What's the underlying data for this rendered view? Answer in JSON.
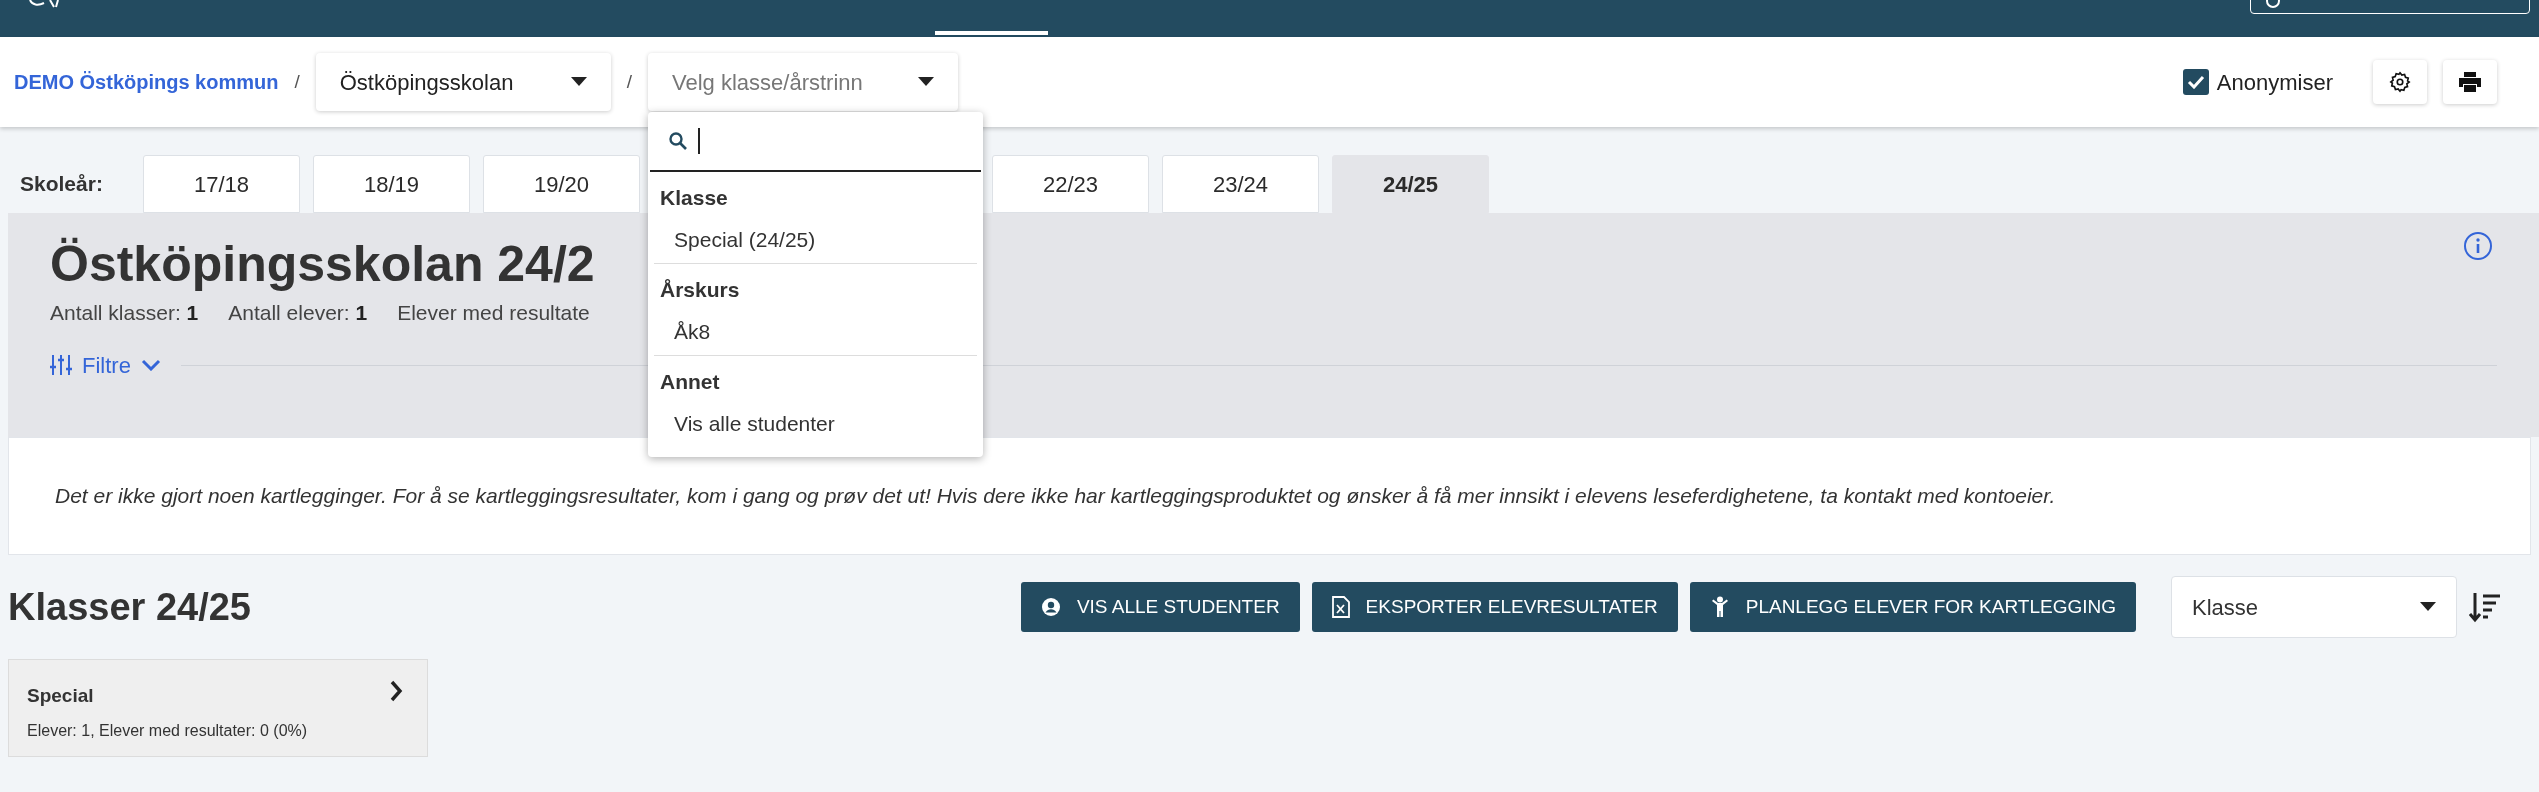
{
  "breadcrumb": {
    "organization": "DEMO Östköpings kommun",
    "separator": "/",
    "school_select": {
      "value": "Östköpingsskolan"
    },
    "class_select": {
      "placeholder": "Velg klasse/årstrinn",
      "expanded": true
    }
  },
  "anonymize": {
    "label": "Anonymiser",
    "checked": true
  },
  "school_year": {
    "label": "Skoleår:",
    "tabs": [
      {
        "label": "17/18",
        "selected": false
      },
      {
        "label": "18/19",
        "selected": false
      },
      {
        "label": "19/20",
        "selected": false
      },
      {
        "label": "22/23",
        "selected": false
      },
      {
        "label": "23/24",
        "selected": false
      },
      {
        "label": "24/25",
        "selected": true
      }
    ]
  },
  "summary": {
    "title": "Östköpingsskolan 24/2",
    "stats": [
      {
        "label": "Antall klasser:",
        "value": "1"
      },
      {
        "label": "Antall elever:",
        "value": "1"
      },
      {
        "label": "Elever med resultate"
      }
    ],
    "filter_toggle": "Filtre"
  },
  "message": "Det er ikke gjort noen kartlegginger. For å se kartleggingsresultater, kom i gang og prøv det ut! Hvis dere ikke har kartleggingsproduktet og ønsker å få mer innsikt i elevens leseferdighetene, ta kontakt med kontoeier.",
  "classes": {
    "title": "Klasser 24/25",
    "buttons": [
      {
        "kind": "person",
        "label": "VIS ALLE STUDENTER"
      },
      {
        "kind": "export",
        "label": "EKSPORTER ELEVRESULTATER"
      },
      {
        "kind": "child",
        "label": "PLANLEGG ELEVER FOR KARTLEGGING"
      }
    ],
    "sort_select": {
      "value": "Klasse"
    },
    "cards": [
      {
        "name": "Special",
        "details": "Elever: 1, Elever med resultater: 0 (0%)"
      }
    ]
  },
  "dropdown": {
    "groups": [
      {
        "heading": "Klasse",
        "items": [
          "Special (24/25)"
        ]
      },
      {
        "heading": "Årskurs",
        "items": [
          "Åk8"
        ]
      },
      {
        "heading": "Annet",
        "items": [
          "Vis alle studenter"
        ]
      }
    ]
  }
}
